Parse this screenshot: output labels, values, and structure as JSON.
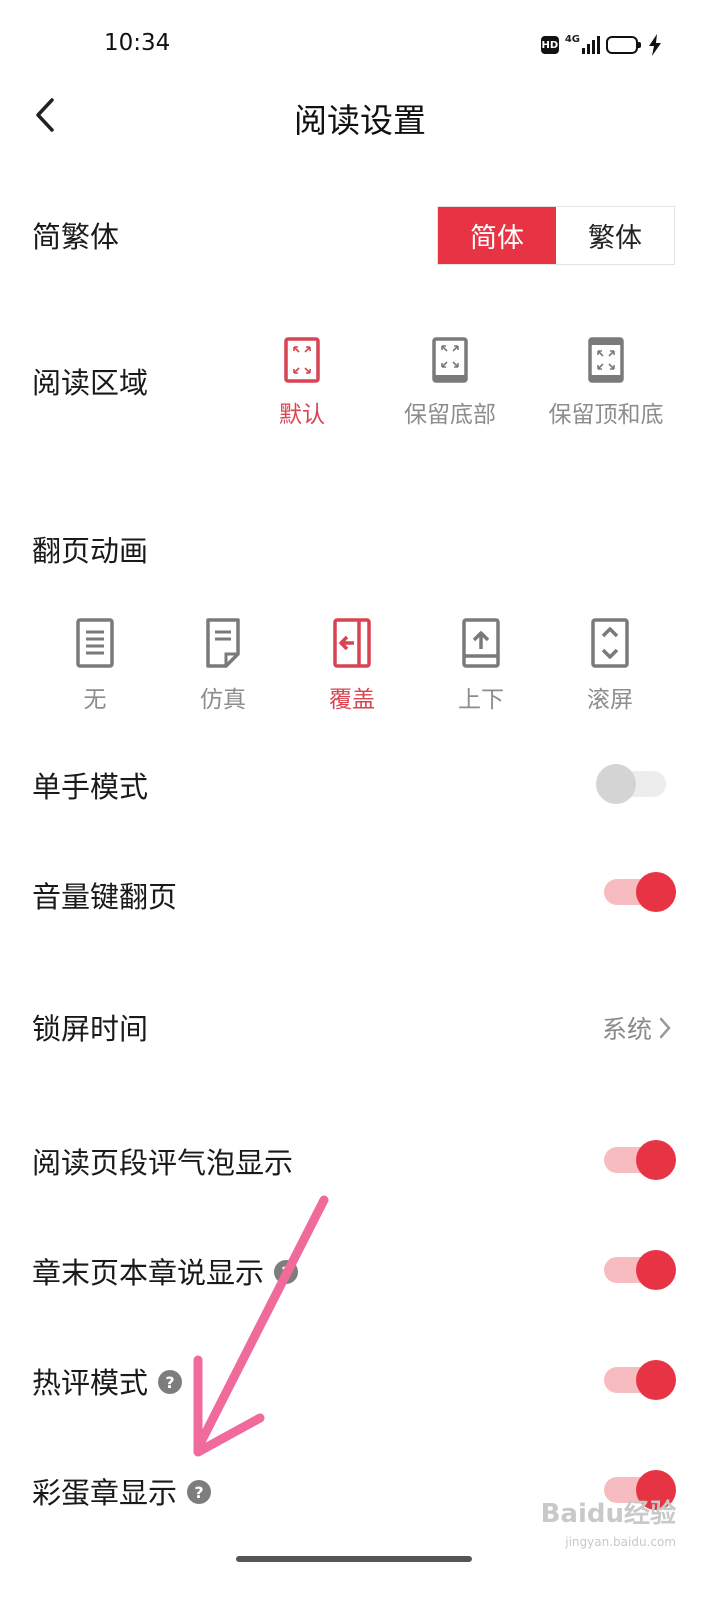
{
  "status_bar": {
    "time": "10:34",
    "network": "4G",
    "hd": "HD",
    "battery_level": 0.45
  },
  "header": {
    "title": "阅读设置"
  },
  "simplified_traditional": {
    "label": "简繁体",
    "options": [
      "简体",
      "繁体"
    ],
    "selected": "简体"
  },
  "reading_area": {
    "label": "阅读区域",
    "options": [
      "默认",
      "保留底部",
      "保留顶和底"
    ],
    "selected": "默认"
  },
  "page_animation": {
    "label": "翻页动画",
    "options": [
      "无",
      "仿真",
      "覆盖",
      "上下",
      "滚屏"
    ],
    "selected": "覆盖"
  },
  "toggles": [
    {
      "label": "单手模式",
      "on": false,
      "help": false
    },
    {
      "label": "音量键翻页",
      "on": true,
      "help": false
    },
    {
      "label": "阅读页段评气泡显示",
      "on": true,
      "help": false
    },
    {
      "label": "章末页本章说显示",
      "on": true,
      "help": true
    },
    {
      "label": "热评模式",
      "on": true,
      "help": true
    },
    {
      "label": "彩蛋章显示",
      "on": true,
      "help": true
    }
  ],
  "lock_screen": {
    "label": "锁屏时间",
    "value": "系统"
  },
  "help_glyph": "?",
  "watermark": {
    "text": "Baidu经验",
    "sub": "jingyan.baidu.com"
  },
  "colors": {
    "accent": "#e73444",
    "accent_light": "#f7bcc0",
    "inactive_icon": "#7a7a7a",
    "annotation_arrow": "#f06b9b"
  },
  "icons": {
    "back": "chevron-left-icon",
    "chevron": "chevron-right-icon"
  }
}
